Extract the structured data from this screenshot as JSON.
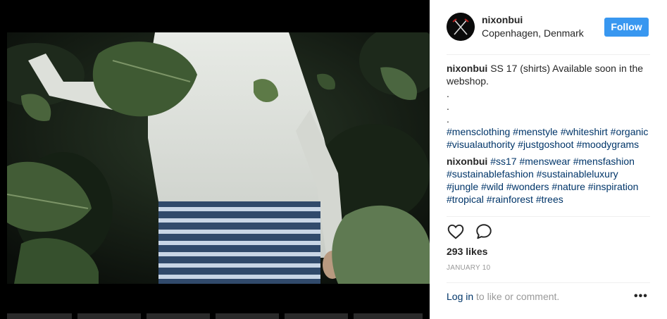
{
  "post": {
    "username": "nixonbui",
    "location": "Copenhagen, Denmark",
    "follow_label": "Follow",
    "likes": "293 likes",
    "date": "JANUARY 10",
    "login_link": "Log in",
    "login_rest": " to like or comment.",
    "more_label": "•••"
  },
  "caption": {
    "user": "nixonbui",
    "text": " SS 17 (shirts) Available soon in the webshop.",
    "dots": [
      ".",
      ".",
      "."
    ],
    "tags": "#mensclothing #menstyle #whiteshirt #organic #visualauthority #justgoshoot #moodygrams"
  },
  "comment": {
    "user": "nixonbui",
    "tags": " #ss17 #menswear #mensfashion #sustainablefashion #sustainableluxury #jungle #wild #wonders #nature #inspiration #tropical #rainforest #trees"
  },
  "icons": {
    "like": "heart-icon",
    "comment": "comment-icon",
    "avatar": "crossed-swords-logo"
  },
  "colors": {
    "accent": "#3897f0",
    "hashtag": "#003569",
    "muted": "#999999"
  }
}
